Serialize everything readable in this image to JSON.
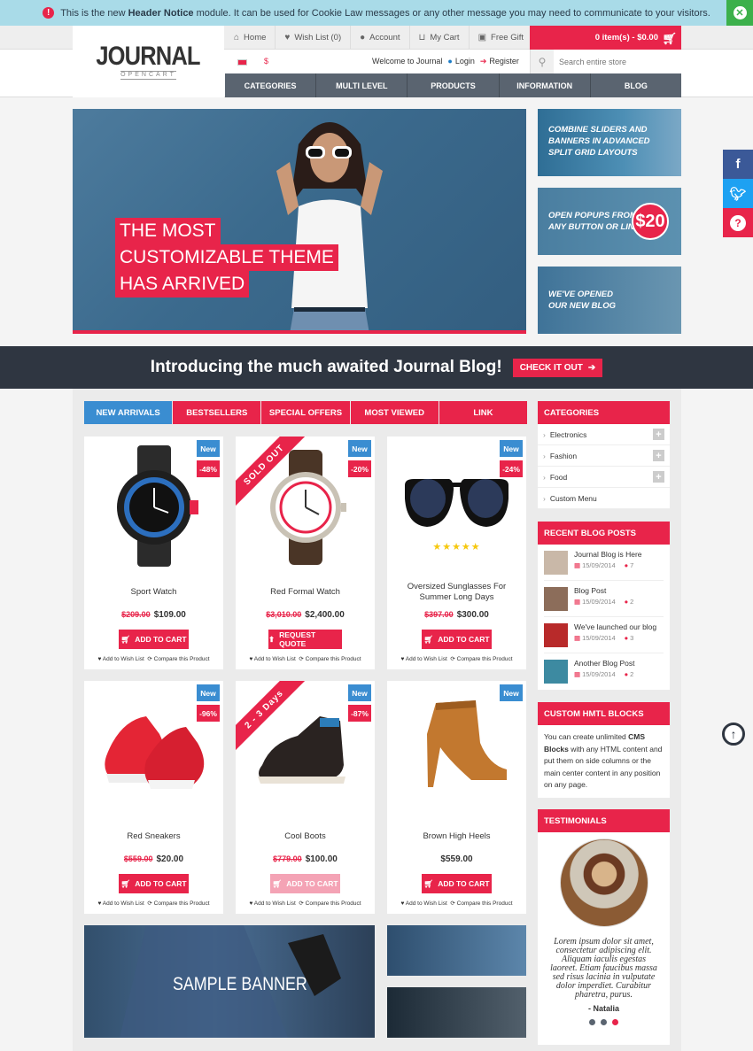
{
  "notice": {
    "pre": "This is the new",
    "bold": "Header Notice",
    "post": "module. It can be used for Cookie Law messages or any other message you may need to communicate to your visitors."
  },
  "logo": {
    "title": "JOURNAL",
    "sub": "OPENCART"
  },
  "toplinks": {
    "home": "Home",
    "wishlist": "Wish List (0)",
    "account": "Account",
    "cart": "My Cart",
    "gift": "Free Gift"
  },
  "cart_summary": "0 item(s) - $0.00",
  "currency": "$",
  "welcome": {
    "text": "Welcome to Journal",
    "login": "Login",
    "register": "Register"
  },
  "search": {
    "placeholder": "Search entire store"
  },
  "nav": [
    "CATEGORIES",
    "MULTI LEVEL",
    "PRODUCTS",
    "INFORMATION",
    "BLOG"
  ],
  "hero": {
    "line1": "THE MOST",
    "line2": "CUSTOMIZABLE THEME",
    "line3": "HAS ARRIVED"
  },
  "side_banners": [
    {
      "l1": "COMBINE SLIDERS AND",
      "l2": "BANNERS IN ADVANCED",
      "l3": "SPLIT GRID LAYOUTS"
    },
    {
      "l1": "OPEN POPUPS FROM",
      "l2": "ANY BUTTON OR LINK",
      "price": "$20"
    },
    {
      "l1": "WE'VE OPENED",
      "l2": "OUR NEW BLOG"
    }
  ],
  "blog_bar": {
    "text": "Introducing the much awaited Journal Blog!",
    "button": "CHECK IT OUT"
  },
  "tabs": [
    "NEW ARRIVALS",
    "BESTSELLERS",
    "SPECIAL OFFERS",
    "MOST VIEWED",
    "LINK"
  ],
  "products": [
    {
      "name": "Sport Watch",
      "old": "$209.00",
      "price": "$109.00",
      "badge": "New",
      "pct": "-48%",
      "button": "ADD TO CART"
    },
    {
      "name": "Red Formal Watch",
      "old": "$3,010.00",
      "price": "$2,400.00",
      "badge": "New",
      "pct": "-20%",
      "button": "REQUEST QUOTE",
      "ribbon": "SOLD OUT"
    },
    {
      "name": "Oversized Sunglasses For Summer Long Days",
      "old": "$397.00",
      "price": "$300.00",
      "badge": "New",
      "pct": "-24%",
      "button": "ADD TO CART",
      "stars": "★★★★★"
    },
    {
      "name": "Red Sneakers",
      "old": "$559.00",
      "price": "$20.00",
      "badge": "New",
      "pct": "-96%",
      "button": "ADD TO CART"
    },
    {
      "name": "Cool Boots",
      "old": "$779.00",
      "price": "$100.00",
      "badge": "New",
      "pct": "-87%",
      "button": "ADD TO CART",
      "ribbon": "2 - 3 Days"
    },
    {
      "name": "Brown High Heels",
      "old": "",
      "price": "$559.00",
      "badge": "New",
      "pct": "",
      "button": "ADD TO CART"
    }
  ],
  "product_links": {
    "wish": "Add to Wish List",
    "compare": "Compare this Product"
  },
  "sample_banner": "SAMPLE BANNER",
  "categories": {
    "title": "CATEGORIES",
    "items": [
      "Electronics",
      "Fashion",
      "Food",
      "Custom Menu"
    ]
  },
  "recent_posts": {
    "title": "RECENT BLOG POSTS",
    "items": [
      {
        "title": "Journal Blog is Here",
        "date": "15/09/2014",
        "comments": "7"
      },
      {
        "title": "Blog Post",
        "date": "15/09/2014",
        "comments": "2"
      },
      {
        "title": "We've launched our blog",
        "date": "15/09/2014",
        "comments": "3"
      },
      {
        "title": "Another Blog Post",
        "date": "15/09/2014",
        "comments": "2"
      }
    ]
  },
  "custom_html": {
    "title": "CUSTOM HMTL BLOCKS",
    "pre": "You can create unlimited",
    "bold": "CMS Blocks",
    "post": "with any HTML content and put them on side columns or the main center content in any position on any page."
  },
  "testimonials": {
    "title": "TESTIMONIALS",
    "quote": "Lorem ipsum dolor sit amet, consectetur adipiscing elit. Aliquam iaculis egestas laoreet. Etiam faucibus massa sed risus lacinia in vulputate dolor imperdiet. Curabitur pharetra, purus.",
    "author": "- Natalia"
  },
  "colors": {
    "accent": "#e8244a",
    "blue": "#3a8dd1",
    "dark": "#2f3641",
    "nav": "#5a6470"
  }
}
